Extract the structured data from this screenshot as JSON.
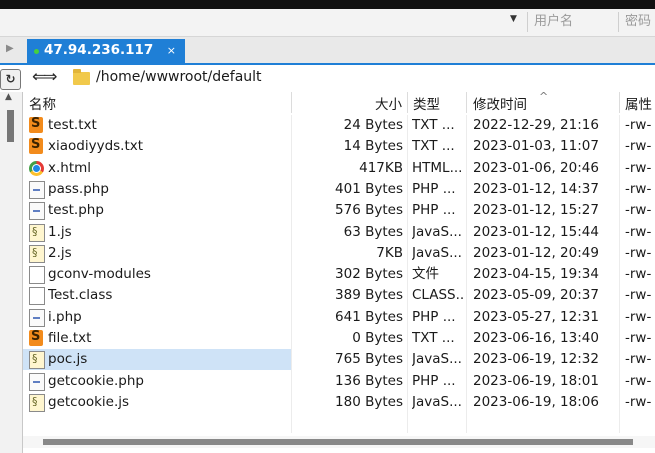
{
  "credentials": {
    "username_placeholder": "用户名",
    "password_placeholder": "密码"
  },
  "tab": {
    "title": "47.94.236.117",
    "close": "×"
  },
  "path": {
    "current": "/home/wwwroot/default"
  },
  "columns": {
    "name": "名称",
    "size": "大小",
    "type": "类型",
    "modified": "修改时间",
    "attributes": "属性"
  },
  "files": [
    {
      "icon": "sublime-icon",
      "name": "test.txt",
      "size": "24 Bytes",
      "type": "TXT ...",
      "modified": "2022-12-29, 21:16",
      "attr": "-rw-"
    },
    {
      "icon": "sublime-icon",
      "name": "xiaodiyyds.txt",
      "size": "14 Bytes",
      "type": "TXT ...",
      "modified": "2023-01-03, 11:07",
      "attr": "-rw-"
    },
    {
      "icon": "chrome-icon",
      "name": "x.html",
      "size": "417KB",
      "type": "HTML...",
      "modified": "2023-01-06, 20:46",
      "attr": "-rw-"
    },
    {
      "icon": "php-file-icon",
      "name": "pass.php",
      "size": "401 Bytes",
      "type": "PHP ...",
      "modified": "2023-01-12, 14:37",
      "attr": "-rw-"
    },
    {
      "icon": "php-file-icon",
      "name": "test.php",
      "size": "576 Bytes",
      "type": "PHP ...",
      "modified": "2023-01-12, 15:27",
      "attr": "-rw-"
    },
    {
      "icon": "js-file-icon",
      "name": "1.js",
      "size": "63 Bytes",
      "type": "JavaS...",
      "modified": "2023-01-12, 15:44",
      "attr": "-rw-"
    },
    {
      "icon": "js-file-icon",
      "name": "2.js",
      "size": "7KB",
      "type": "JavaS...",
      "modified": "2023-01-12, 20:49",
      "attr": "-rw-"
    },
    {
      "icon": "blank-file-icon",
      "name": "gconv-modules",
      "size": "302 Bytes",
      "type": "文件",
      "modified": "2023-04-15, 19:34",
      "attr": "-rw-"
    },
    {
      "icon": "blank-file-icon",
      "name": "Test.class",
      "size": "389 Bytes",
      "type": "CLASS...",
      "modified": "2023-05-09, 20:37",
      "attr": "-rw-"
    },
    {
      "icon": "php-file-icon",
      "name": "i.php",
      "size": "641 Bytes",
      "type": "PHP ...",
      "modified": "2023-05-27, 12:31",
      "attr": "-rw-"
    },
    {
      "icon": "sublime-icon",
      "name": "file.txt",
      "size": "0 Bytes",
      "type": "TXT ...",
      "modified": "2023-06-16, 13:40",
      "attr": "-rw-"
    },
    {
      "icon": "js-file-icon",
      "name": "poc.js",
      "size": "765 Bytes",
      "type": "JavaS...",
      "modified": "2023-06-19, 12:32",
      "attr": "-rw-",
      "selected": true
    },
    {
      "icon": "php-file-icon",
      "name": "getcookie.php",
      "size": "136 Bytes",
      "type": "PHP ...",
      "modified": "2023-06-19, 18:01",
      "attr": "-rw-"
    },
    {
      "icon": "js-file-icon",
      "name": "getcookie.js",
      "size": "180 Bytes",
      "type": "JavaS...",
      "modified": "2023-06-19, 18:06",
      "attr": "-rw-"
    }
  ],
  "colors": {
    "tab_active": "#1f7fd6",
    "selection": "#cfe3f7",
    "connected_dot": "#46d13c"
  }
}
